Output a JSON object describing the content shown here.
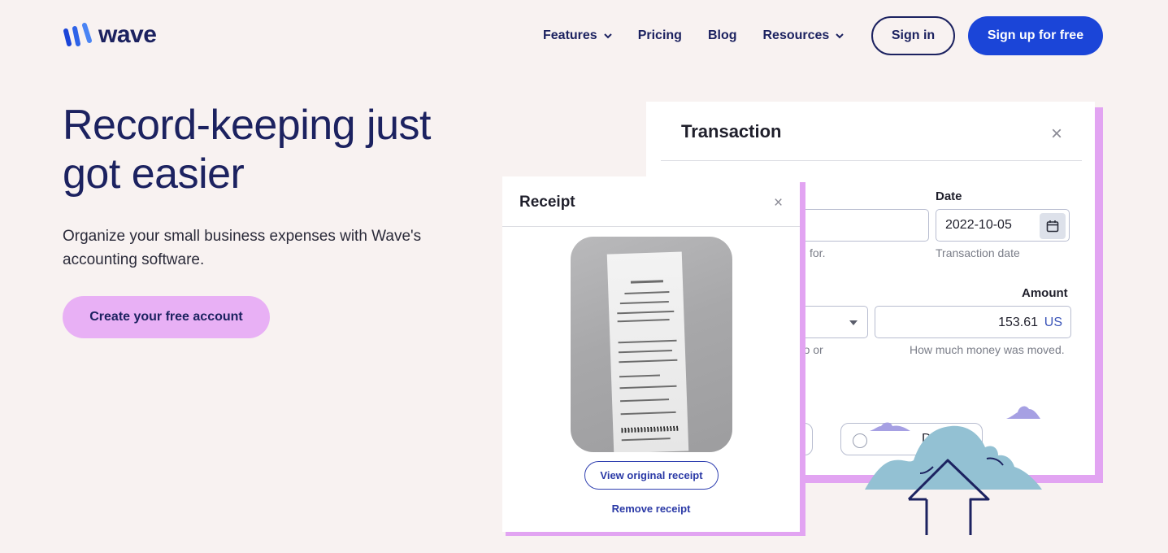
{
  "brand": {
    "name": "wave",
    "accent": "#1b45d8",
    "pink": "#e8b0f5",
    "navy": "#1c2260"
  },
  "nav": {
    "items": [
      {
        "label": "Features",
        "has_dropdown": true
      },
      {
        "label": "Pricing",
        "has_dropdown": false
      },
      {
        "label": "Blog",
        "has_dropdown": false
      },
      {
        "label": "Resources",
        "has_dropdown": true
      }
    ],
    "signin": "Sign in",
    "signup": "Sign up for free"
  },
  "hero": {
    "title": "Record-keeping just got easier",
    "subtitle": "Organize your small business expenses with Wave's accounting software.",
    "cta": "Create your free account"
  },
  "transaction": {
    "title": "Transaction",
    "close": "×",
    "desc_hint_fragment": "for.",
    "date_label": "Date",
    "date_value": "2022-10-05",
    "date_hint": "Transaction date",
    "amount_label": "Amount",
    "amount_value": "153.61",
    "amount_currency": "US",
    "amount_hint": "How much money was moved.",
    "account_hint_fragment": "g to or",
    "radio_fragment": "D"
  },
  "receipt": {
    "title": "Receipt",
    "close": "×",
    "view": "View original receipt",
    "remove": "Remove receipt"
  }
}
